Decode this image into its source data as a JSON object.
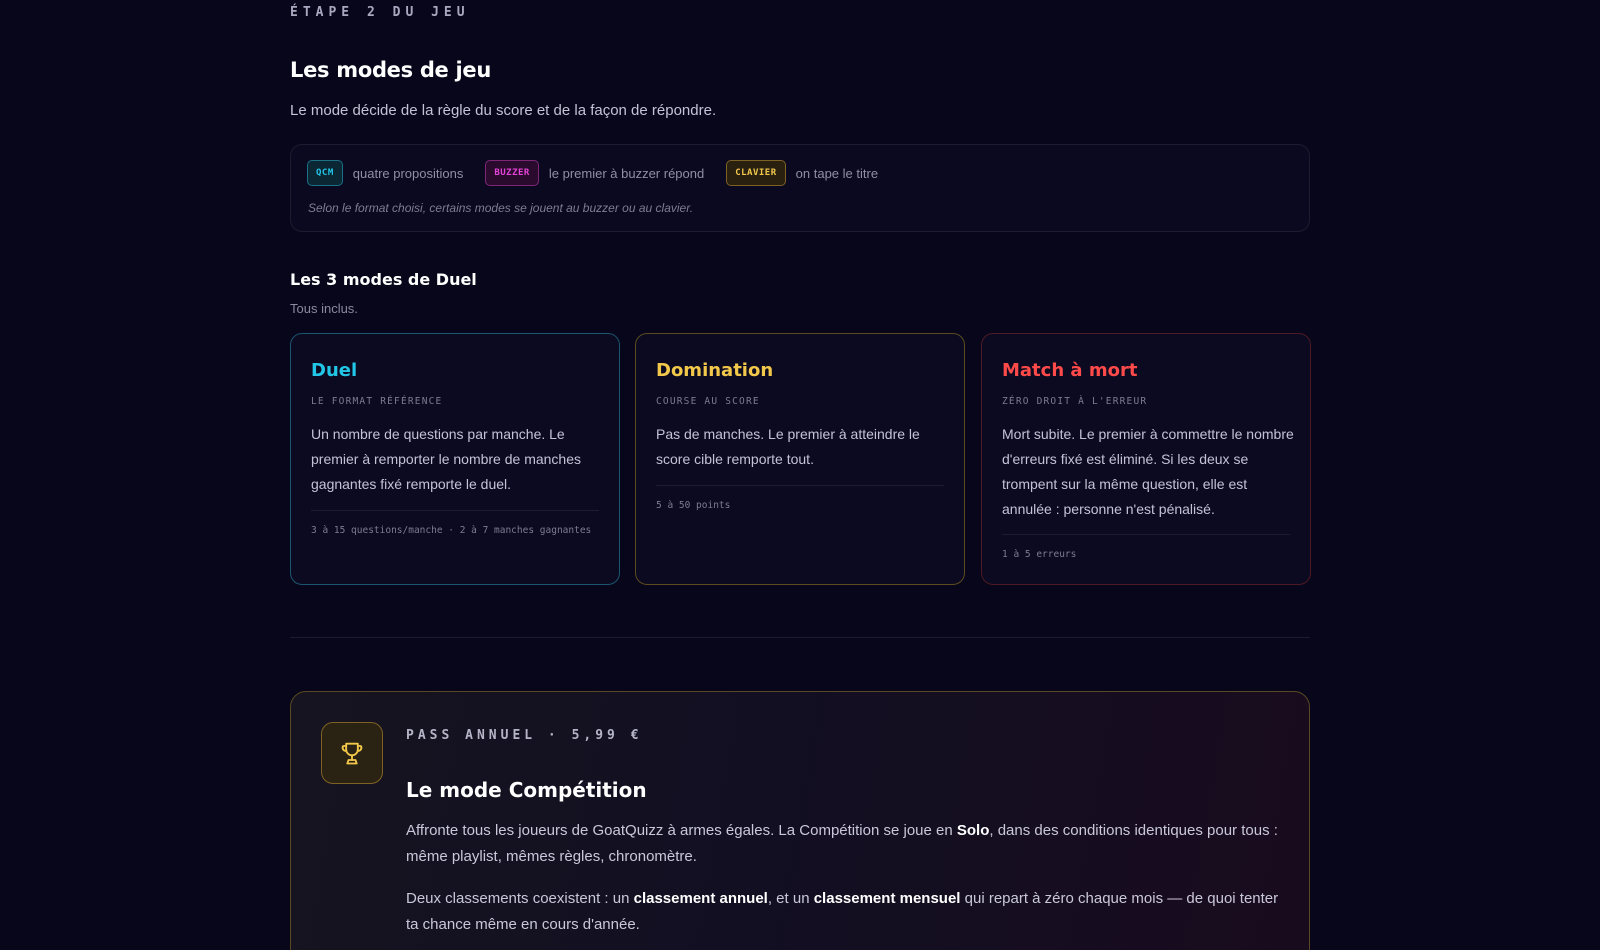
{
  "section": {
    "eyebrow": "ÉTAPE 2 DU JEU",
    "title": "Les modes de jeu",
    "lead": "Le mode décide de la règle du score et de la façon de répondre."
  },
  "legend": {
    "items": [
      {
        "tag": "QCM",
        "text": "quatre propositions"
      },
      {
        "tag": "BUZZER",
        "text": "le premier à buzzer répond"
      },
      {
        "tag": "CLAVIER",
        "text": "on tape le titre"
      }
    ],
    "note": "Selon le format choisi, certains modes se jouent au buzzer ou au clavier."
  },
  "duel_modes": {
    "title": "Les 3 modes de Duel",
    "subtitle": "Tous inclus.",
    "cards": [
      {
        "title": "Duel",
        "tag": "LE FORMAT RÉFÉRENCE",
        "desc": "Un nombre de questions par manche. Le premier à remporter le nombre de manches gagnantes fixé remporte le duel.",
        "foot": "3 à 15 questions/manche · 2 à 7 manches gagnantes",
        "color": "#22c7e8"
      },
      {
        "title": "Domination",
        "tag": "COURSE AU SCORE",
        "desc": "Pas de manches. Le premier à atteindre le score cible remporte tout.",
        "foot": "5 à 50 points",
        "color": "#f2c84b"
      },
      {
        "title": "Match à mort",
        "tag": "ZÉRO DROIT À L'ERREUR",
        "desc": "Mort subite. Le premier à commettre le nombre d'erreurs fixé est éliminé. Si les deux se trompent sur la même question, elle est annulée : personne n'est pénalisé.",
        "foot": "1 à 5 erreurs",
        "color": "#ff4a4a"
      }
    ]
  },
  "competition": {
    "icon": "trophy-icon",
    "eyebrow": "PASS ANNUEL · 5,99 €",
    "title": "Le mode Compétition",
    "p1": {
      "before": "Affronte tous les joueurs de GoatQuizz à armes égales. La Compétition se joue en ",
      "bold": "Solo",
      "after": ", dans des conditions identiques pour tous : même playlist, mêmes règles, chronomètre."
    },
    "p2": {
      "before": "Deux classements coexistent : un ",
      "bold1": "classement annuel",
      "mid": ", et un ",
      "bold2": "classement mensuel",
      "after": " qui repart à zéro chaque mois — de quoi tenter ta chance même en cours d'année."
    }
  }
}
